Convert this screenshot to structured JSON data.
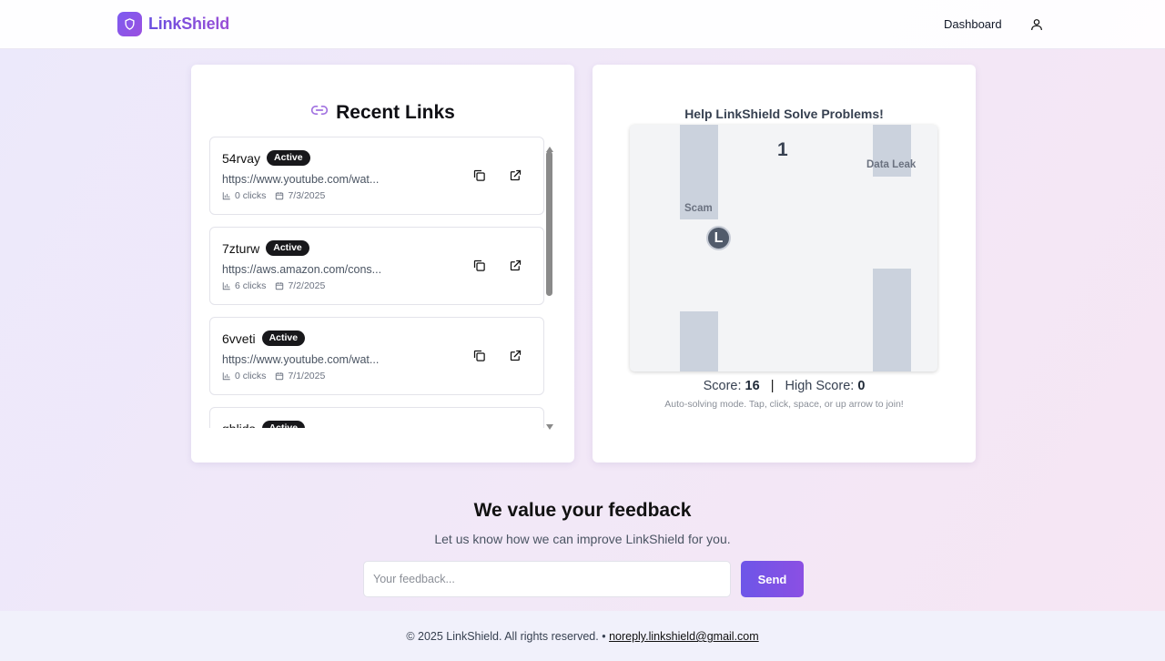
{
  "header": {
    "brand": "LinkShield",
    "nav_dashboard": "Dashboard"
  },
  "recent_links": {
    "title": "Recent Links",
    "items": [
      {
        "code": "54rvay",
        "status": "Active",
        "url": "https://www.youtube.com/wat...",
        "clicks": "0 clicks",
        "date": "7/3/2025"
      },
      {
        "code": "7zturw",
        "status": "Active",
        "url": "https://aws.amazon.com/cons...",
        "clicks": "6 clicks",
        "date": "7/2/2025"
      },
      {
        "code": "6vveti",
        "status": "Active",
        "url": "https://www.youtube.com/wat...",
        "clicks": "0 clicks",
        "date": "7/1/2025"
      },
      {
        "code": "ghlids",
        "status": "Active",
        "url": "",
        "clicks": "",
        "date": ""
      }
    ]
  },
  "game": {
    "title": "Help LinkShield Solve Problems!",
    "current_count": "1",
    "obstacle_labels": [
      "Scam",
      "Data Leak"
    ],
    "player_letter": "L",
    "score_label": "Score:",
    "score": "16",
    "separator": "|",
    "high_score_label": "High Score:",
    "high_score": "0",
    "hint": "Auto-solving mode. Tap, click, space, or up arrow to join!"
  },
  "feedback": {
    "title": "We value your feedback",
    "subtitle": "Let us know how we can improve LinkShield for you.",
    "placeholder": "Your feedback...",
    "send_label": "Send"
  },
  "footer": {
    "copyright": "© 2025 LinkShield. All rights reserved. •",
    "email": "noreply.linkshield@gmail.com"
  },
  "colors": {
    "accent": "#7c5cf0",
    "badge_bg": "#18181b",
    "pipe": "#cbd2dd"
  }
}
